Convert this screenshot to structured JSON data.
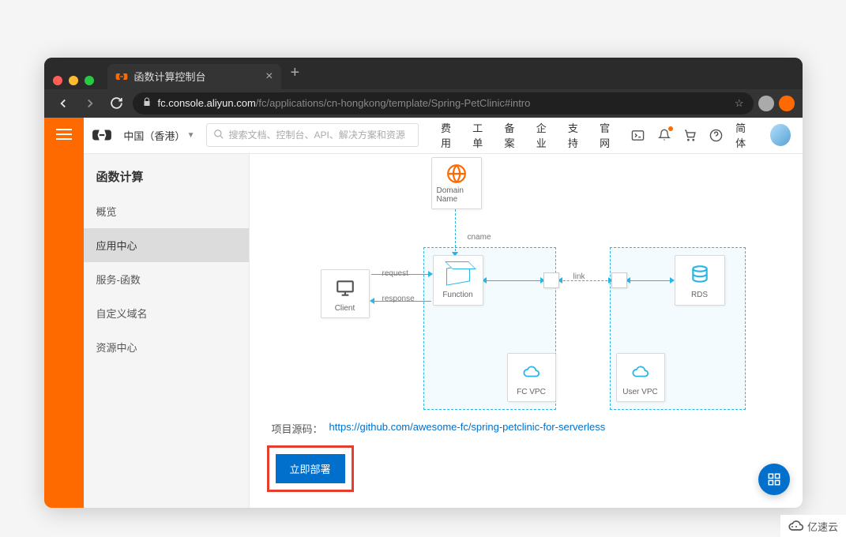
{
  "browser": {
    "tab_title": "函数计算控制台",
    "url_domain": "fc.console.aliyun.com",
    "url_path": "/fc/applications/cn-hongkong/template/Spring-PetClinic#intro"
  },
  "header": {
    "region": "中国（香港）",
    "search_placeholder": "搜索文档、控制台、API、解决方案和资源",
    "links": [
      "费用",
      "工单",
      "备案",
      "企业",
      "支持",
      "官网"
    ],
    "lang": "简体"
  },
  "sidebar": {
    "title": "函数计算",
    "items": [
      {
        "label": "概览",
        "active": false
      },
      {
        "label": "应用中心",
        "active": true
      },
      {
        "label": "服务-函数",
        "active": false
      },
      {
        "label": "自定义域名",
        "active": false
      },
      {
        "label": "资源中心",
        "active": false
      }
    ]
  },
  "diagram": {
    "domain": "Domain Name",
    "client": "Client",
    "function": "Function",
    "rds": "RDS",
    "fcvpc": "FC VPC",
    "uservpc": "User VPC",
    "cname": "cname",
    "request": "request",
    "response": "response",
    "link": "link"
  },
  "source": {
    "label": "项目源码：",
    "url": "https://github.com/awesome-fc/spring-petclinic-for-serverless"
  },
  "deploy_button": "立即部署",
  "watermark": "亿速云"
}
